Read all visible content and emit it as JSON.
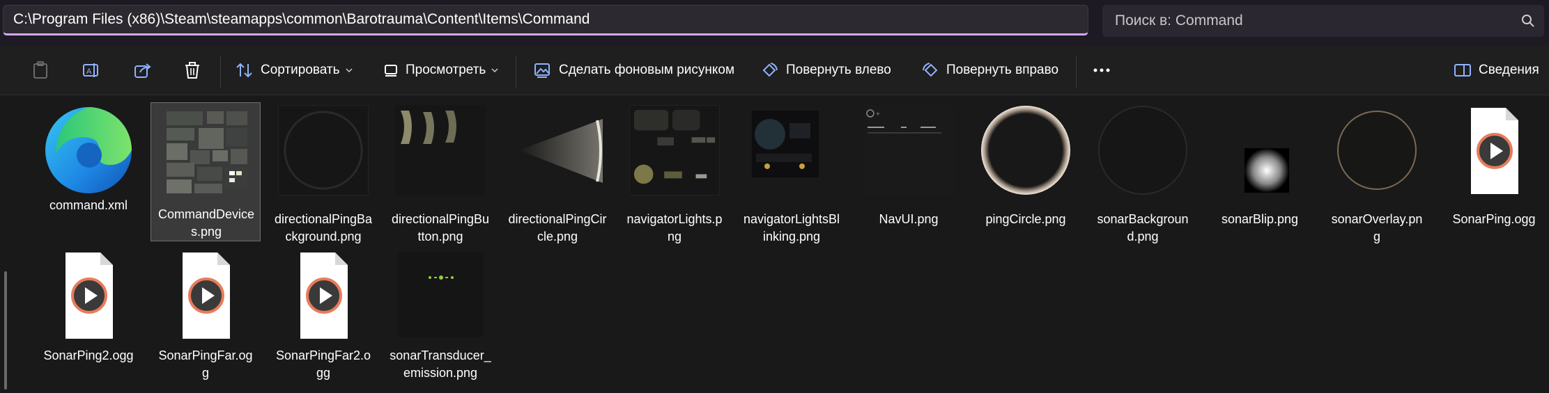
{
  "address": {
    "path": "C:\\Program Files (x86)\\Steam\\steamapps\\common\\Barotrauma\\Content\\Items\\Command"
  },
  "search": {
    "placeholder": "Поиск в: Command"
  },
  "toolbar": {
    "sort_label": "Сортировать",
    "view_label": "Просмотреть",
    "set_background_label": "Сделать фоновым рисунком",
    "rotate_left_label": "Повернуть влево",
    "rotate_right_label": "Повернуть вправо",
    "details_label": "Сведения"
  },
  "files": [
    {
      "line1": "command.xml",
      "line2": "",
      "icon": "edge-icon"
    },
    {
      "line1": "CommandDevice",
      "line2": "s.png",
      "icon": "image-thumbnail",
      "selected": true
    },
    {
      "line1": "directionalPingBa",
      "line2": "ckground.png",
      "icon": "image-thumbnail"
    },
    {
      "line1": "directionalPingBu",
      "line2": "tton.png",
      "icon": "image-thumbnail"
    },
    {
      "line1": "directionalPingCir",
      "line2": "cle.png",
      "icon": "image-thumbnail"
    },
    {
      "line1": "navigatorLights.p",
      "line2": "ng",
      "icon": "image-thumbnail"
    },
    {
      "line1": "navigatorLightsBl",
      "line2": "inking.png",
      "icon": "image-thumbnail"
    },
    {
      "line1": "NavUI.png",
      "line2": "",
      "icon": "image-thumbnail"
    },
    {
      "line1": "pingCircle.png",
      "line2": "",
      "icon": "image-thumbnail"
    },
    {
      "line1": "sonarBackgroun",
      "line2": "d.png",
      "icon": "image-thumbnail"
    },
    {
      "line1": "sonarBlip.png",
      "line2": "",
      "icon": "image-thumbnail"
    },
    {
      "line1": "sonarOverlay.pn",
      "line2": "g",
      "icon": "image-thumbnail"
    },
    {
      "line1": "SonarPing.ogg",
      "line2": "",
      "icon": "media-file-icon"
    },
    {
      "line1": "SonarPing2.ogg",
      "line2": "",
      "icon": "media-file-icon"
    },
    {
      "line1": "SonarPingFar.og",
      "line2": "g",
      "icon": "media-file-icon"
    },
    {
      "line1": "SonarPingFar2.o",
      "line2": "gg",
      "icon": "media-file-icon"
    },
    {
      "line1": "sonarTransducer_",
      "line2": "emission.png",
      "icon": "image-thumbnail"
    }
  ],
  "colors": {
    "accent": "#d4a6ff",
    "background": "#191919",
    "selection": "#3a3a3a"
  }
}
